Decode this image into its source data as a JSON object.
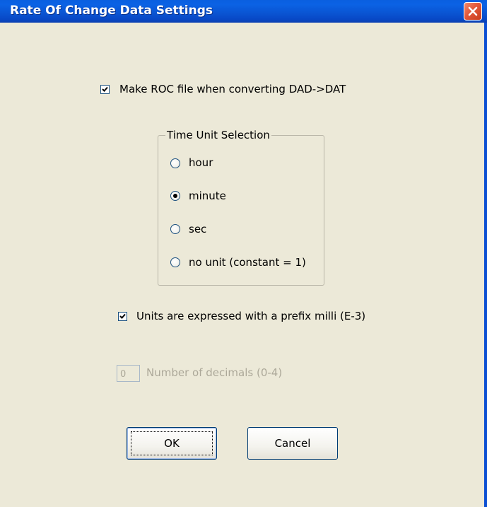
{
  "window": {
    "title": "Rate Of Change Data Settings",
    "close_icon": "close-icon"
  },
  "make_roc": {
    "label": "Make ROC file when converting DAD->DAT",
    "checked": true
  },
  "time_unit": {
    "legend": "Time Unit Selection",
    "options": [
      {
        "label": "hour",
        "selected": false
      },
      {
        "label": "minute",
        "selected": true
      },
      {
        "label": "sec",
        "selected": false
      },
      {
        "label": "no unit (constant = 1)",
        "selected": false
      }
    ]
  },
  "milli_prefix": {
    "label": "Units are expressed with a prefix milli (E-3)",
    "checked": true
  },
  "decimals": {
    "value": "0",
    "label": "Number of decimals (0-4)",
    "enabled": false
  },
  "buttons": {
    "ok": "OK",
    "cancel": "Cancel"
  },
  "colors": {
    "titlebar": "#0a5fe0",
    "dialog_bg": "#ece9d8",
    "close_button": "#e2573a",
    "disabled_text": "#aca899"
  }
}
